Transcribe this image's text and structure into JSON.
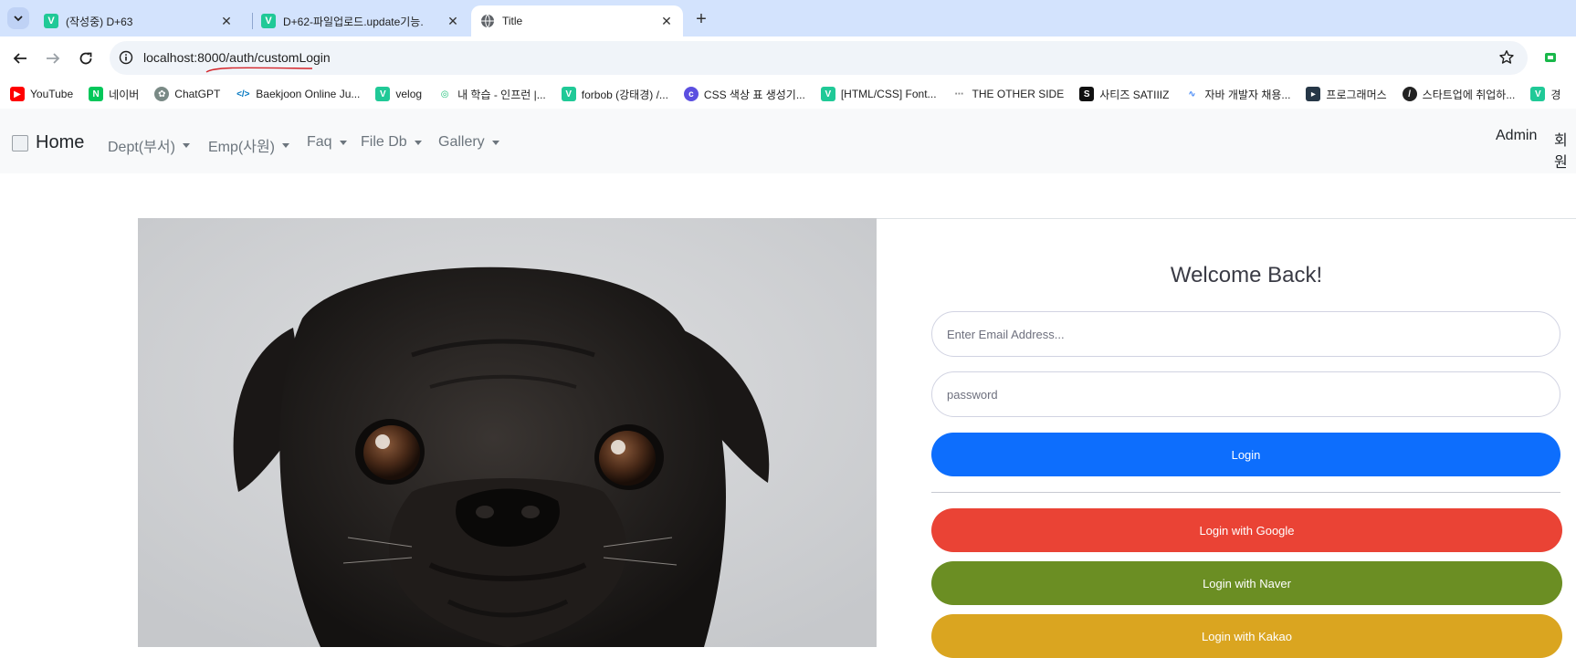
{
  "tabs": [
    {
      "title": "(작성중) D+63",
      "favicon": "velog-v"
    },
    {
      "title": "D+62-파일업로드.update기능.",
      "favicon": "velog-v"
    },
    {
      "title": "Title",
      "favicon": "globe-icon"
    }
  ],
  "address_bar": {
    "url_host": "localhost:8000",
    "url_path": "/auth/customLogin"
  },
  "bookmarks": [
    {
      "label": "YouTube",
      "icon": "youtube-icon",
      "color": "#ff0000"
    },
    {
      "label": "네이버",
      "icon": "naver-icon",
      "color": "#03c75a"
    },
    {
      "label": "ChatGPT",
      "icon": "chatgpt-icon",
      "color": "#7a8a86"
    },
    {
      "label": "Baekjoon Online Ju...",
      "icon": "code-icon",
      "color": "#0076c0"
    },
    {
      "label": "velog",
      "icon": "velog-icon",
      "color": "#20c997"
    },
    {
      "label": "내 학습 - 인프런 |...",
      "icon": "inflearn-icon",
      "color": "#1dc078"
    },
    {
      "label": "forbob (강태경) /...",
      "icon": "velog-icon",
      "color": "#20c997"
    },
    {
      "label": "CSS 색상 표 생성기...",
      "icon": "css-icon",
      "color": "#5b4fe0"
    },
    {
      "label": "[HTML/CSS] Font...",
      "icon": "velog-icon",
      "color": "#20c997"
    },
    {
      "label": "THE OTHER SIDE",
      "icon": "theotherside-icon",
      "color": "#8a8a8a"
    },
    {
      "label": "사티즈 SATIIIZ",
      "icon": "satiiiz-icon",
      "color": "#111111"
    },
    {
      "label": "자바 개발자 채용...",
      "icon": "job-icon",
      "color": "#3b82f6"
    },
    {
      "label": "프로그래머스",
      "icon": "programmers-icon",
      "color": "#263747"
    },
    {
      "label": "스타트업에 취업하...",
      "icon": "startup-icon",
      "color": "#222222"
    },
    {
      "label": "경",
      "icon": "velog-icon",
      "color": "#20c997"
    }
  ],
  "navbar": {
    "brand": "Home",
    "menus": [
      "Dept(부서)",
      "Emp(사원)",
      "Faq",
      "File Db",
      "Gallery"
    ],
    "right": [
      "Admin",
      "회원"
    ]
  },
  "login": {
    "heading": "Welcome Back!",
    "email_placeholder": "Enter Email Address...",
    "password_placeholder": "password",
    "login_button": "Login",
    "google_button": "Login with Google",
    "naver_button": "Login with Naver",
    "kakao_button": "Login with Kakao"
  },
  "colors": {
    "login": "#0d6efd",
    "google": "#ea4335",
    "naver": "#6b8e23",
    "kakao": "#daa520"
  }
}
